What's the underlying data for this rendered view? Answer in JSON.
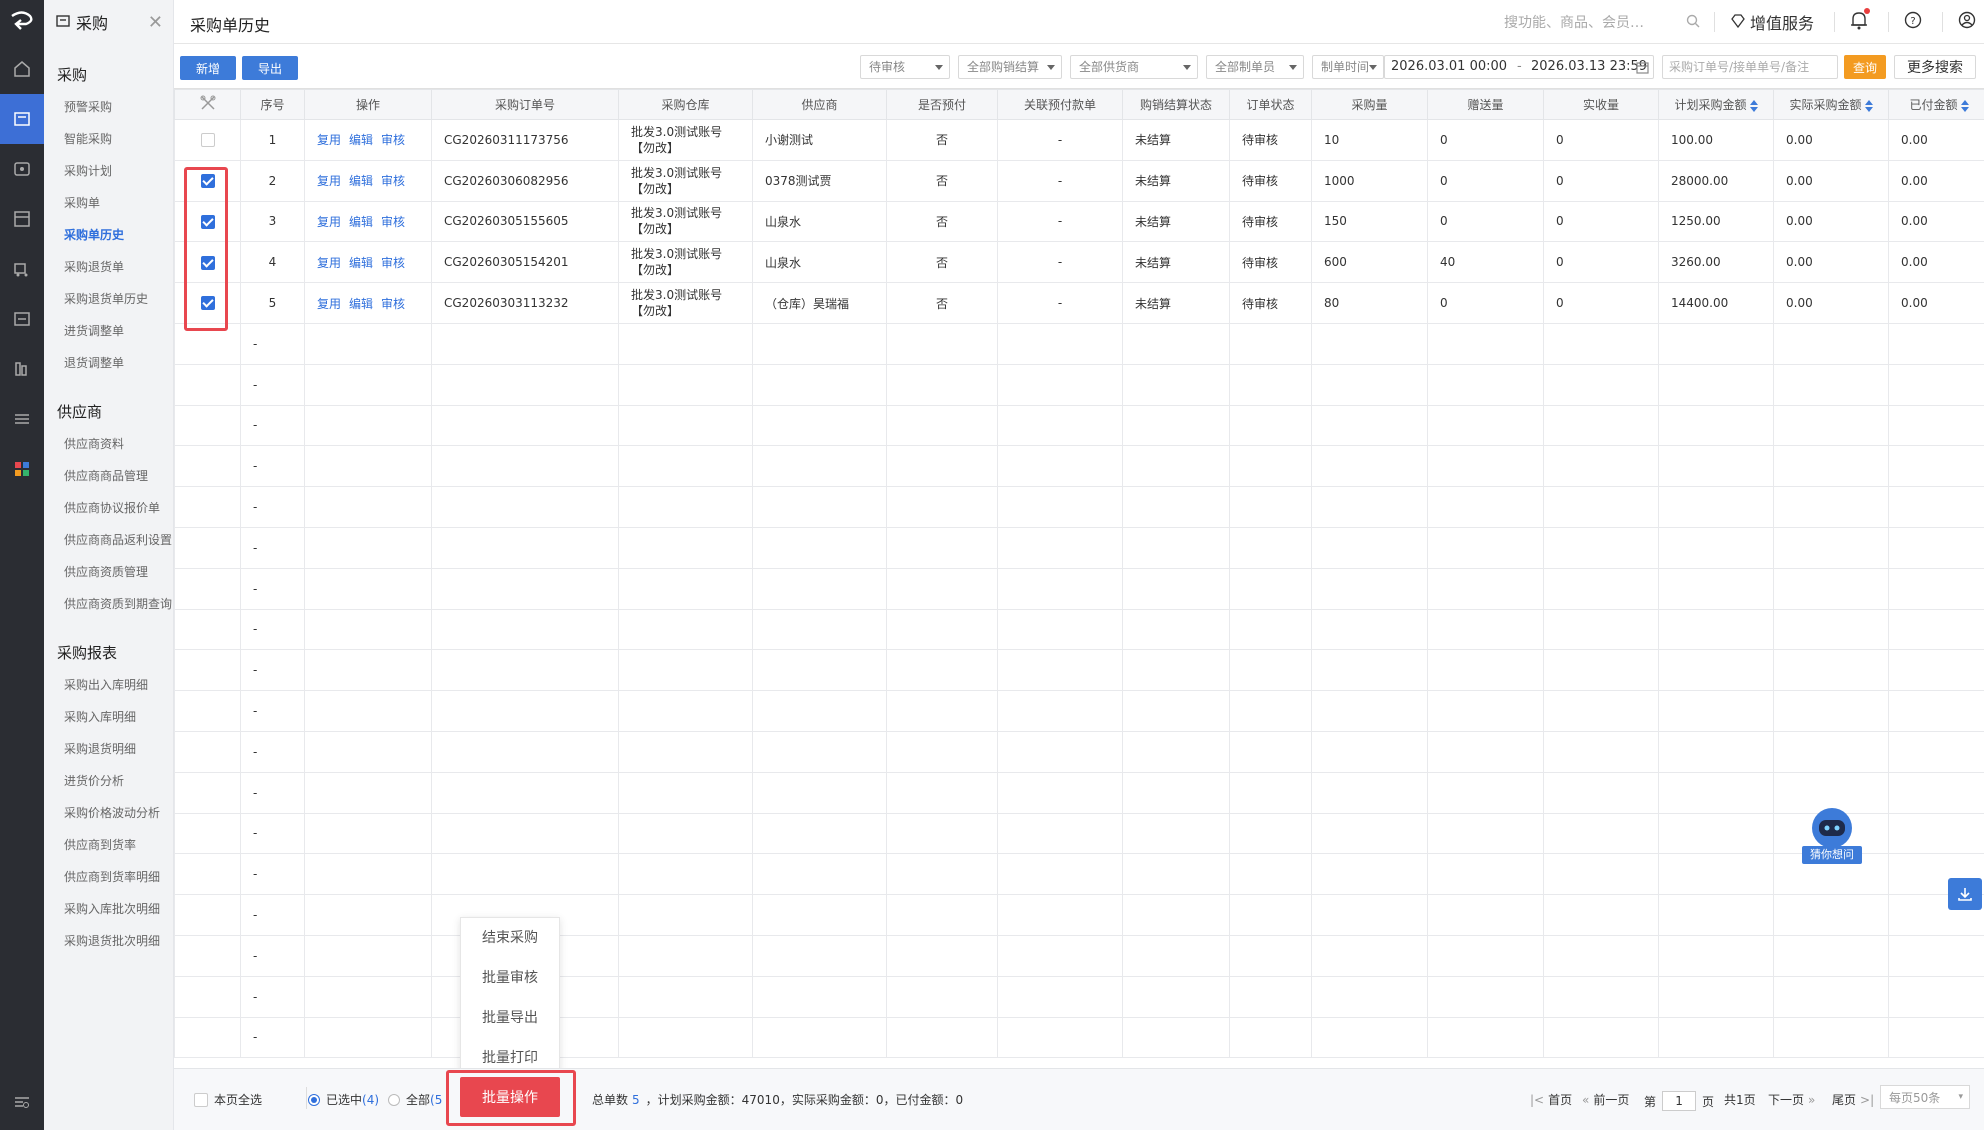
{
  "app": {
    "module_title": "采购",
    "page_title": "采购单历史"
  },
  "menu": {
    "groups": [
      {
        "title": "采购",
        "items": [
          "预警采购",
          "智能采购",
          "采购计划",
          "采购单",
          "采购单历史",
          "采购退货单",
          "采购退货单历史",
          "进货调整单",
          "退货调整单"
        ]
      },
      {
        "title": "供应商",
        "items": [
          "供应商资料",
          "供应商商品管理",
          "供应商协议报价单",
          "供应商商品返利设置",
          "供应商资质管理",
          "供应商资质到期查询"
        ]
      },
      {
        "title": "采购报表",
        "items": [
          "采购出入库明细",
          "采购入库明细",
          "采购退货明细",
          "进货价分析",
          "采购价格波动分析",
          "供应商到货率",
          "供应商到货率明细",
          "采购入库批次明细",
          "采购退货批次明细"
        ]
      }
    ],
    "active_item": "采购单历史"
  },
  "header": {
    "search_placeholder": "搜功能、商品、会员…",
    "value_added": "增值服务"
  },
  "toolbar": {
    "add": "新增",
    "export": "导出",
    "filter_status": "待审核",
    "filter_settle": "全部购销结算",
    "filter_supplier": "全部供货商",
    "filter_creator": "全部制单员",
    "filter_time": "制单时间",
    "date_from": "2026.03.01 00:00",
    "date_sep": "-",
    "date_to": "2026.03.13 23:59",
    "keyword_placeholder": "采购订单号/接单单号/备注",
    "query": "查询",
    "more_search": "更多搜索"
  },
  "table": {
    "headers": [
      "序号",
      "操作",
      "采购订单号",
      "采购仓库",
      "供应商",
      "是否预付",
      "关联预付款单",
      "购销结算状态",
      "订单状态",
      "采购量",
      "赠送量",
      "实收量",
      "计划采购金额",
      "实际采购金额",
      "已付金额"
    ],
    "actions": [
      "复用",
      "编辑",
      "审核"
    ],
    "rows": [
      {
        "checked": false,
        "no": "1",
        "order": "CG20260311173756",
        "warehouse": "批发3.0测试账号【勿改】",
        "supplier": "小谢测试",
        "prepaid": "否",
        "prepay_doc": "-",
        "settle": "未结算",
        "status": "待审核",
        "qty": "10",
        "gift": "0",
        "received": "0",
        "plan_amt": "100.00",
        "actual_amt": "0.00",
        "paid": "0.00"
      },
      {
        "checked": true,
        "no": "2",
        "order": "CG20260306082956",
        "warehouse": "批发3.0测试账号【勿改】",
        "supplier": "0378测试贾",
        "prepaid": "否",
        "prepay_doc": "-",
        "settle": "未结算",
        "status": "待审核",
        "qty": "1000",
        "gift": "0",
        "received": "0",
        "plan_amt": "28000.00",
        "actual_amt": "0.00",
        "paid": "0.00"
      },
      {
        "checked": true,
        "no": "3",
        "order": "CG20260305155605",
        "warehouse": "批发3.0测试账号【勿改】",
        "supplier": "山泉水",
        "prepaid": "否",
        "prepay_doc": "-",
        "settle": "未结算",
        "status": "待审核",
        "qty": "150",
        "gift": "0",
        "received": "0",
        "plan_amt": "1250.00",
        "actual_amt": "0.00",
        "paid": "0.00"
      },
      {
        "checked": true,
        "no": "4",
        "order": "CG20260305154201",
        "warehouse": "批发3.0测试账号【勿改】",
        "supplier": "山泉水",
        "prepaid": "否",
        "prepay_doc": "-",
        "settle": "未结算",
        "status": "待审核",
        "qty": "600",
        "gift": "40",
        "received": "0",
        "plan_amt": "3260.00",
        "actual_amt": "0.00",
        "paid": "0.00"
      },
      {
        "checked": true,
        "no": "5",
        "order": "CG20260303113232",
        "warehouse": "批发3.0测试账号【勿改】",
        "supplier": "（仓库）昊瑞福",
        "prepaid": "否",
        "prepay_doc": "-",
        "settle": "未结算",
        "status": "待审核",
        "qty": "80",
        "gift": "0",
        "received": "0",
        "plan_amt": "14400.00",
        "actual_amt": "0.00",
        "paid": "0.00"
      }
    ],
    "empty_row_mark": "-"
  },
  "popup": {
    "items": [
      "结束采购",
      "批量审核",
      "批量导出",
      "批量打印"
    ],
    "batch_button": "批量操作"
  },
  "footer": {
    "select_page": "本页全选",
    "selected_label": "已选中",
    "selected_count": "(4)",
    "all_label": "全部",
    "all_count": "(5",
    "total_label": "总单数",
    "total_value": "5",
    "summary": "，计划采购金额：47010，实际采购金额：0，已付金额：0",
    "first": "首页",
    "prev": "前一页",
    "page_prefix": "第",
    "page_value": "1",
    "page_suffix": "页",
    "page_total": "共1页",
    "next": "下一页",
    "last": "尾页",
    "per_page": "每页50条"
  },
  "bot": {
    "label": "猜你想问"
  }
}
